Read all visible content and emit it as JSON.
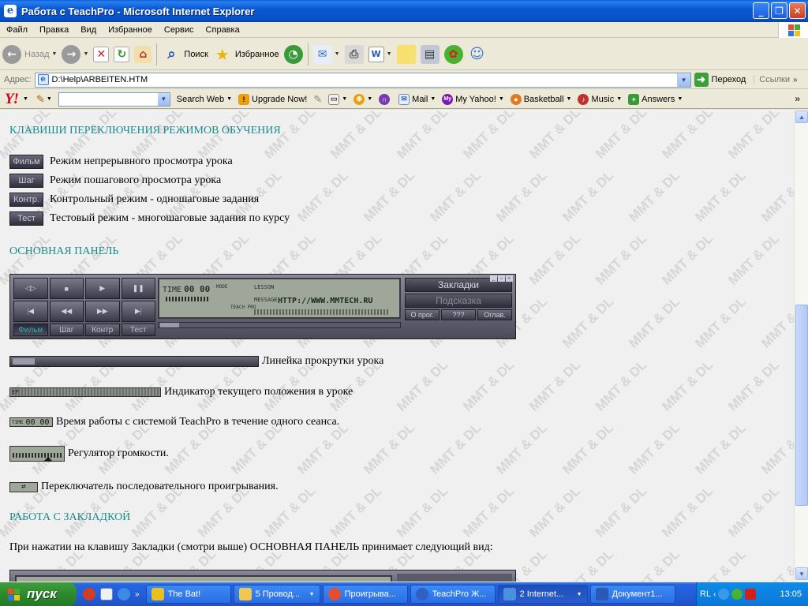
{
  "window": {
    "title": "Работа с TeachPro - Microsoft Internet Explorer",
    "buttons": {
      "minimize": "_",
      "maximize": "❐",
      "close": "✕"
    }
  },
  "menu": [
    "Файл",
    "Правка",
    "Вид",
    "Избранное",
    "Сервис",
    "Справка"
  ],
  "toolbar": {
    "back": "Назад",
    "search": "Поиск",
    "favorites": "Избранное"
  },
  "address": {
    "label": "Адрес:",
    "value": "D:\\Help\\ARBEITEN.HTM",
    "go": "Переход",
    "links": "Ссылки"
  },
  "yahoo": {
    "logo": "Y!",
    "search_web": "Search Web",
    "upgrade": "Upgrade Now!",
    "mail": "Mail",
    "my_yahoo": "My Yahoo!",
    "basketball": "Basketball",
    "music": "Music",
    "answers": "Answers"
  },
  "content": {
    "watermark": "MMT & DL",
    "h1": "КЛАВИШИ ПЕРЕКЛЮЧЕНИЯ РЕЖИМОВ ОБУЧЕНИЯ",
    "modes": [
      {
        "key": "Фильм",
        "text": "Режим непрерывного просмотра урока"
      },
      {
        "key": "Шаг",
        "text": "Режим пошагового просмотра урока"
      },
      {
        "key": "Контр.",
        "text": "Контрольный режим - одношаговые задания"
      },
      {
        "key": "Тест",
        "text": "Тестовый режим - многошаговые задания по курсу"
      }
    ],
    "h2": "ОСНОВНАЯ ПАНЕЛЬ",
    "player": {
      "tabs": [
        "Фильм",
        "Шаг",
        "Контр",
        "Тест"
      ],
      "keys": [
        "◁▷",
        "■",
        "▶",
        "❚❚",
        "|◀",
        "◀◀",
        "▶▶",
        "▶|"
      ],
      "time_label": "TIME",
      "time": "00 00",
      "mode_label": "MODE",
      "lesson_label": "LESSON",
      "message_label": "MESSAGE",
      "url": "HTTP://WWW.MMTECH.RU",
      "teachpro": "TEACH PRO",
      "bookmarks": "Закладки",
      "hint": "Подсказка",
      "about": "О прог.",
      "q": "???",
      "index": "Оглав."
    },
    "items": [
      {
        "text": "Линейка прокрутки урока"
      },
      {
        "text": "Индикатор текущего положения в уроке"
      },
      {
        "text": "Время работы с системой TeachPro в течение одного сеанса.",
        "widget": "00 00"
      },
      {
        "text": "Регулятор громкости."
      },
      {
        "text": "Переключатель последовательного проигрывания."
      }
    ],
    "h3": "РАБОТА С ЗАКЛАДКОЙ",
    "para": "При нажатии на клавишу Закладки (смотри выше) ОСНОВНАЯ ПАНЕЛЬ принимает следующий вид:"
  },
  "taskbar": {
    "start": "пуск",
    "tasks": [
      {
        "label": "The Bat!",
        "color": "#e8c020"
      },
      {
        "label": "5 Провод...",
        "color": "#f0c850"
      },
      {
        "label": "Проигрыва...",
        "color": "#e05030"
      },
      {
        "label": "TeachPro Ж...",
        "color": "#3060c0"
      },
      {
        "label": "2 Internet...",
        "color": "#4a90e0"
      },
      {
        "label": "Документ1...",
        "color": "#2a5ab8"
      }
    ],
    "lang": "RL",
    "clock": "13:05"
  }
}
